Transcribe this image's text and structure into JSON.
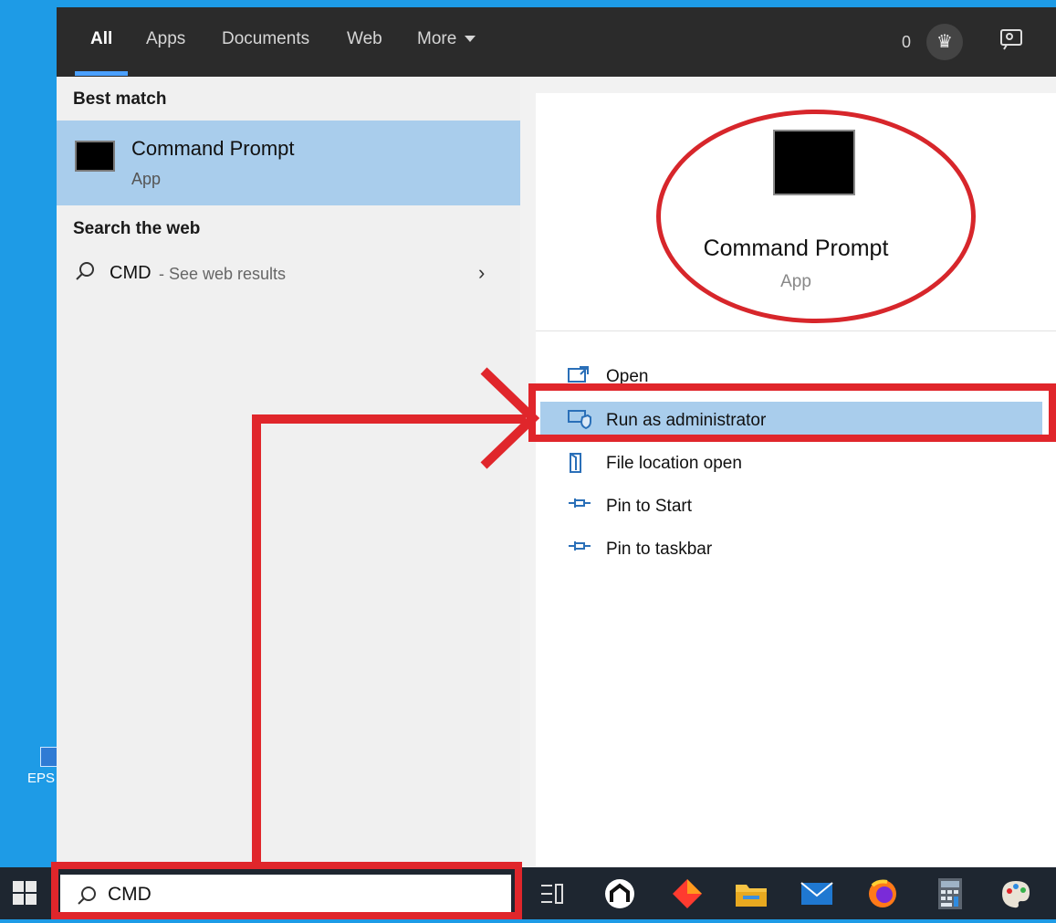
{
  "desktop": {
    "icon_label": "EPS"
  },
  "top_tabs": [
    {
      "label": "All"
    },
    {
      "label": "Apps"
    },
    {
      "label": "Documents"
    },
    {
      "label": "Web"
    },
    {
      "label": "More"
    }
  ],
  "header": {
    "points": "0"
  },
  "left": {
    "best_match_title": "Best match",
    "best_match": {
      "title": "Command Prompt",
      "subtitle": "App"
    },
    "search_web_title": "Search the web",
    "web_result": {
      "query": "CMD",
      "hint": "- See web results"
    }
  },
  "detail": {
    "title": "Command Prompt",
    "subtitle": "App",
    "actions": [
      {
        "label": "Open",
        "icon": "open-icon"
      },
      {
        "label": "Run as administrator",
        "icon": "shield-icon"
      },
      {
        "label": "File location open",
        "icon": "file-icon"
      },
      {
        "label": "Pin to Start",
        "icon": "pin-icon"
      },
      {
        "label": "Pin to taskbar",
        "icon": "pin-icon"
      }
    ]
  },
  "taskbar": {
    "search_value": "CMD"
  },
  "colors": {
    "accent": "#4aa0ff",
    "highlight": "#a9cdec",
    "annotation": "#e0262b"
  }
}
